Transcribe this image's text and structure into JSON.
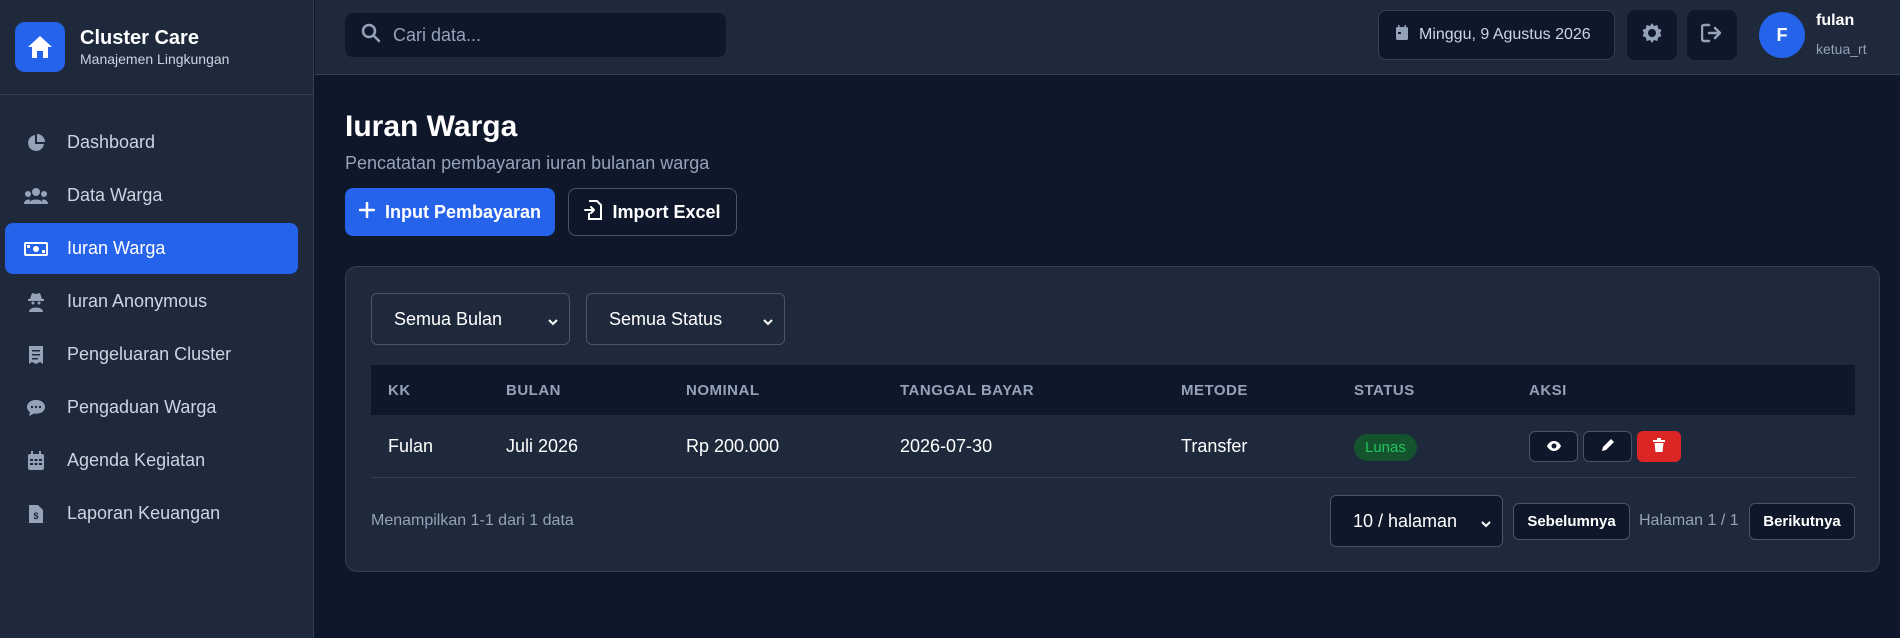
{
  "brand": {
    "title": "Cluster Care",
    "subtitle": "Manajemen Lingkungan"
  },
  "sidebar": {
    "items": [
      {
        "label": "Dashboard",
        "icon": "pie-chart-icon",
        "active": false
      },
      {
        "label": "Data Warga",
        "icon": "users-icon",
        "active": false
      },
      {
        "label": "Iuran Warga",
        "icon": "money-icon",
        "active": true
      },
      {
        "label": "Iuran Anonymous",
        "icon": "user-secret-icon",
        "active": false
      },
      {
        "label": "Pengeluaran Cluster",
        "icon": "receipt-icon",
        "active": false
      },
      {
        "label": "Pengaduan Warga",
        "icon": "comment-icon",
        "active": false
      },
      {
        "label": "Agenda Kegiatan",
        "icon": "calendar-icon",
        "active": false
      },
      {
        "label": "Laporan Keuangan",
        "icon": "file-invoice-icon",
        "active": false
      }
    ]
  },
  "topbar": {
    "search_placeholder": "Cari data...",
    "date": "Minggu, 9 Agustus 2026",
    "user": {
      "initial": "F",
      "name": "fulan",
      "role": "ketua_rt"
    }
  },
  "page": {
    "title": "Iuran Warga",
    "subtitle": "Pencatatan pembayaran iuran bulanan warga",
    "input_button": "Input Pembayaran",
    "import_button": "Import Excel"
  },
  "filters": {
    "month": "Semua Bulan",
    "status": "Semua Status"
  },
  "table": {
    "headers": [
      "KK",
      "BULAN",
      "NOMINAL",
      "TANGGAL BAYAR",
      "METODE",
      "STATUS",
      "AKSI"
    ],
    "rows": [
      {
        "kk": "Fulan",
        "bulan": "Juli 2026",
        "nominal": "Rp 200.000",
        "tanggal": "2026-07-30",
        "metode": "Transfer",
        "status": "Lunas"
      }
    ]
  },
  "pagination": {
    "info": "Menampilkan 1-1 dari 1 data",
    "per_page": "10 / halaman",
    "prev": "Sebelumnya",
    "page_info": "Halaman 1 / 1",
    "next": "Berikutnya"
  },
  "colors": {
    "accent": "#2563eb",
    "bg": "#0f172a",
    "panel": "#1e293b",
    "success": "#22c55e",
    "danger": "#dc2626"
  }
}
